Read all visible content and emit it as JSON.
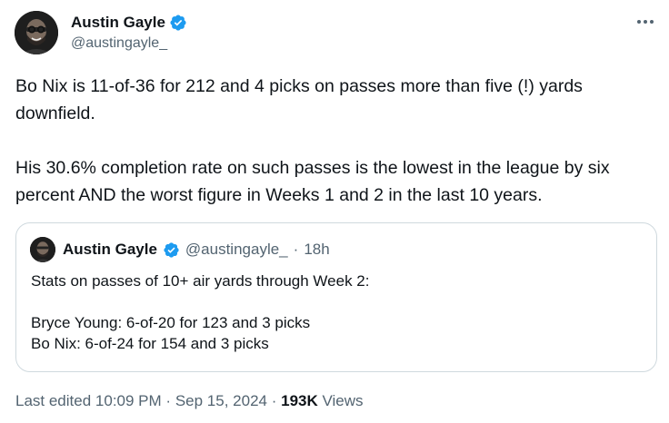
{
  "tweet": {
    "author": {
      "name": "Austin Gayle",
      "handle": "@austingayle_"
    },
    "text": "Bo Nix is 11-of-36 for 212 and 4 picks on passes more than five (!) yards downfield.\n\nHis 30.6% completion rate on such passes is the lowest in the league by six percent AND the worst figure in Weeks 1 and 2 in the last 10 years.",
    "quoted": {
      "name": "Austin Gayle",
      "handle": "@austingayle_",
      "separator": "·",
      "time": "18h",
      "text": "Stats on passes of 10+ air yards through Week 2:\n\nBryce Young: 6-of-20 for 123 and 3 picks\nBo Nix: 6-of-24 for 154 and 3 picks"
    },
    "footer": {
      "edited_label": "Last edited",
      "time": "10:09 PM",
      "separator": "·",
      "date": "Sep 15, 2024",
      "views_count": "193K",
      "views_label": "Views"
    }
  },
  "icons": {
    "verified": "verified-badge-icon",
    "more": "more-options-icon"
  },
  "colors": {
    "verified_blue": "#1d9bf0",
    "text_primary": "#0f1419",
    "text_secondary": "#536471",
    "border": "#cfd9de"
  }
}
